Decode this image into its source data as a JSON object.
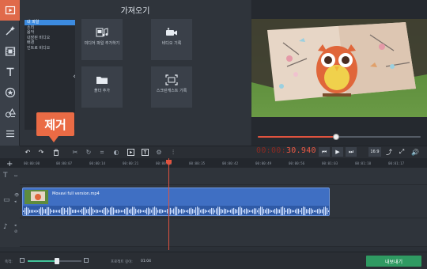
{
  "colors": {
    "accent": "#e06a4a",
    "selection": "#3c8be0",
    "clip": "#3f6fc3",
    "playhead": "#e0533f",
    "export": "#2f9a62"
  },
  "left_toolbar": {
    "tools": [
      {
        "icon": "import-media-icon",
        "active": true
      },
      {
        "icon": "magic-wand-icon",
        "active": false
      },
      {
        "icon": "filmstrip-icon",
        "active": false
      },
      {
        "icon": "titles-icon",
        "active": false
      },
      {
        "icon": "star-sticker-icon",
        "active": false
      },
      {
        "icon": "shapes-icon",
        "active": false
      },
      {
        "icon": "menu-list-icon",
        "active": false
      }
    ]
  },
  "import_panel": {
    "title": "가져오기",
    "categories": [
      "내 파일",
      "소리",
      "음악",
      "내장된 비디오",
      "배경",
      "인트로 비디오"
    ],
    "selected_category": 0,
    "tiles": [
      {
        "icon": "media-files-icon",
        "label": "미디어 파일 추가하기"
      },
      {
        "icon": "video-camera-icon",
        "label": "비디오 기록"
      },
      {
        "icon": "folder-icon",
        "label": "폴더 추가"
      },
      {
        "icon": "screen-capture-icon",
        "label": "스크린캐스트 기록"
      }
    ]
  },
  "callout": {
    "text": "제거"
  },
  "preview": {
    "progress": 0.48,
    "timecode_dim": "00:00:",
    "timecode_hot": "30.940",
    "aspect_ratio": "16:9"
  },
  "timeline": {
    "ruler_ticks": [
      "00:00:00",
      "00:00:07",
      "00:00:14",
      "00:00:21",
      "00:00:28",
      "00:00:35",
      "00:00:42",
      "00:00:49",
      "00:00:56",
      "00:01:03",
      "00:01:10",
      "00:01:17"
    ],
    "clip_name": "Movavi full version.mp4"
  },
  "bottom_bar": {
    "scale_label": "축척:",
    "zoom_level": 0.55,
    "duration_label": "프로젝트 길이:",
    "duration_value": "01:04",
    "export_label": "내보내기"
  }
}
